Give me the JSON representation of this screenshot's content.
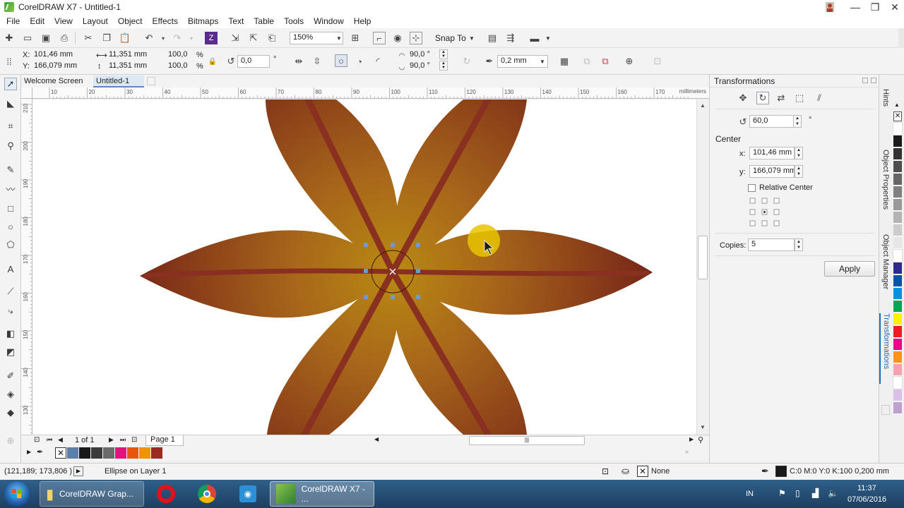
{
  "window": {
    "title": "CorelDRAW X7 - Untitled-1",
    "minimize": "—",
    "maximize": "❐",
    "close": "✕"
  },
  "menu": [
    "File",
    "Edit",
    "View",
    "Layout",
    "Object",
    "Effects",
    "Bitmaps",
    "Text",
    "Table",
    "Tools",
    "Window",
    "Help"
  ],
  "standard_toolbar": {
    "zoom_value": "150%",
    "snap_to_label": "Snap To"
  },
  "property_bar": {
    "x_label": "X:",
    "x_value": "101,46 mm",
    "y_label": "Y:",
    "y_value": "166,079 mm",
    "width_value": "11,351 mm",
    "height_value": "11,351 mm",
    "scale_w": "100,0",
    "scale_h": "100,0",
    "percent": "%",
    "rotation_value": "0,0",
    "degree": "°",
    "start_angle": "90,0 °",
    "end_angle": "90,0 °",
    "outline_width": "0,2 mm"
  },
  "doc_tabs": [
    "Welcome Screen",
    "Untitled-1"
  ],
  "ruler": {
    "top_labels": [
      "10",
      "20",
      "30",
      "40",
      "50",
      "60",
      "70",
      "80",
      "90",
      "100",
      "110",
      "120",
      "130",
      "140",
      "150",
      "160",
      "170"
    ],
    "unit": "millimeters",
    "left_labels": [
      "210",
      "200",
      "190",
      "180",
      "170",
      "160",
      "150",
      "140",
      "130"
    ],
    "left_unit": "millimeters"
  },
  "page_nav": {
    "page_counter": "1 of 1",
    "page_tab": "Page 1"
  },
  "docker": {
    "title": "Transformations",
    "rotation_value": "60,0",
    "degree": "°",
    "center_label": "Center",
    "x_label": "x:",
    "x_value": "101,46 mm",
    "y_label": "y:",
    "y_value": "166,079 mm",
    "relative_center_label": "Relative Center",
    "copies_label": "Copies:",
    "copies_value": "5",
    "apply_label": "Apply"
  },
  "docker_tabs": [
    "Hints",
    "Object Properties",
    "Object Manager",
    "Transformations"
  ],
  "status": {
    "coords": "(121,189; 173,806 )",
    "selection": "Ellipse on Layer 1",
    "fill_label": "None",
    "outline_info": "C:0 M:0 Y:0 K:100  0,200 mm"
  },
  "taskbar": {
    "items": [
      "CorelDRAW Grap...",
      "CorelDRAW X7 - ..."
    ],
    "lang": "IN",
    "time": "11:37",
    "date": "07/06/2016"
  },
  "colors": {
    "petal_light": "#b98a12",
    "petal_dark": "#7a2a1a",
    "vein": "#8a3020",
    "accent_tab": "#1b6fb5",
    "highlight": "#e8c400"
  },
  "palette_bottom": [
    "#5b7fa8",
    "#1a1a1a",
    "#3b3b3b",
    "#6b6b6b",
    "#e5127d",
    "#e8560e",
    "#f39200",
    "#9b2a22"
  ],
  "palette_right": [
    "#ffffff",
    "#1a1a1a",
    "#333333",
    "#4d4d4d",
    "#666666",
    "#808080",
    "#999999",
    "#b3b3b3",
    "#cccccc",
    "#e6e6e6",
    "#ffffff",
    "#2d2a8a",
    "#0055a5",
    "#0093dd",
    "#00a651",
    "#fff200",
    "#ed1c24",
    "#ec008c",
    "#f7941d",
    "#f6a1b0",
    "#ffffff",
    "#d8c0e8",
    "#c0a0d0"
  ]
}
